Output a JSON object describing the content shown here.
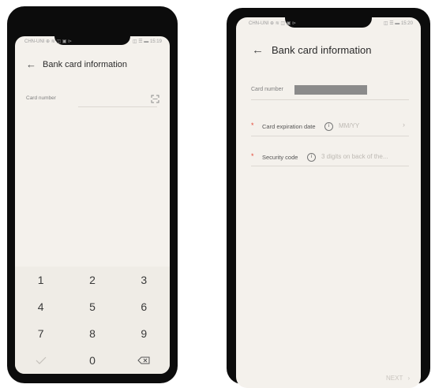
{
  "left_phone": {
    "status_left": "CHN-UNI ⊕ ≋ ◫ ▣ ⊳",
    "status_right": "◫ ☰ ▬ 15:19",
    "header": {
      "title": "Bank card information"
    },
    "card_number_label": "Card number",
    "keypad": [
      "1",
      "2",
      "3",
      "4",
      "5",
      "6",
      "7",
      "8",
      "9",
      "",
      "0",
      ""
    ]
  },
  "right_phone": {
    "status_left": "CHN-UNI ⊕ ≋ ◫ ▣ ⊳",
    "status_right": "◫ ☰ ▬ 15:20",
    "header": {
      "title": "Bank card information"
    },
    "card_number_label": "Card number",
    "expiration": {
      "label": "Card expiration date",
      "placeholder": "MM/YY"
    },
    "security": {
      "label": "Security code",
      "placeholder": "3 digits on back of the..."
    },
    "next_label": "NEXT",
    "required_mark": "*"
  }
}
